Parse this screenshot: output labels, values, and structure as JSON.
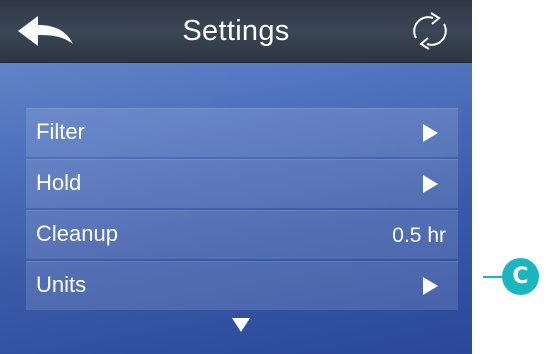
{
  "header": {
    "title": "Settings",
    "back_icon": "back-arrow-icon",
    "refresh_icon": "refresh-icon"
  },
  "settings_items": [
    {
      "label": "Filter",
      "indicator": "right-arrow"
    },
    {
      "label": "Hold",
      "indicator": "right-arrow"
    },
    {
      "label": "Cleanup",
      "value": "0.5 hr"
    },
    {
      "label": "Units",
      "indicator": "right-arrow"
    }
  ],
  "scroll": {
    "icon": "down-arrow-icon"
  },
  "callout": {
    "letter": "C",
    "color": "#19b6bf"
  },
  "colors": {
    "header_bg": "#343e4d",
    "screen_bg": "#4f72bd",
    "text": "#ffffff"
  }
}
